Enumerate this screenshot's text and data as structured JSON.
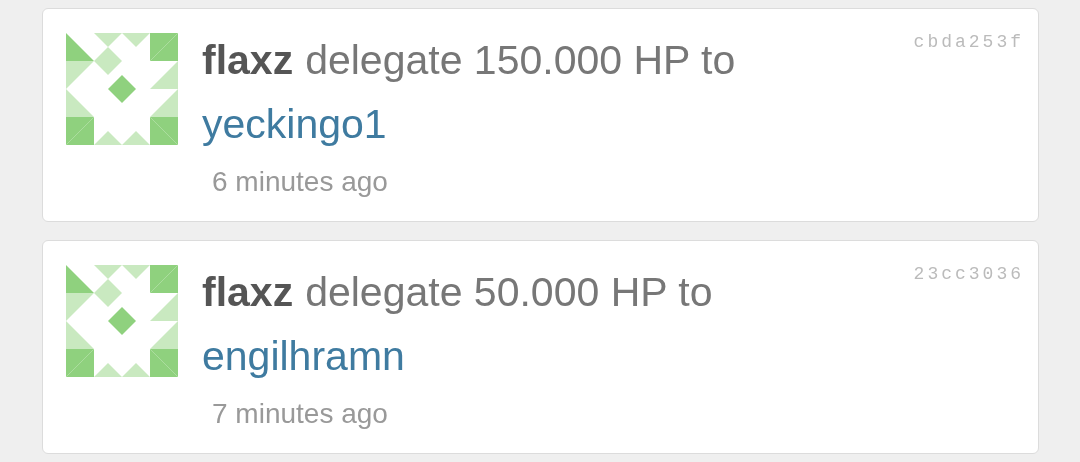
{
  "items": [
    {
      "user": "flaxz",
      "action": "delegate 150.000 HP to",
      "target": "yeckingo1",
      "time": "6 minutes ago",
      "hash": "cbda253f"
    },
    {
      "user": "flaxz",
      "action": "delegate 50.000 HP to",
      "target": "engilhramn",
      "time": "7 minutes ago",
      "hash": "23cc3036"
    }
  ]
}
